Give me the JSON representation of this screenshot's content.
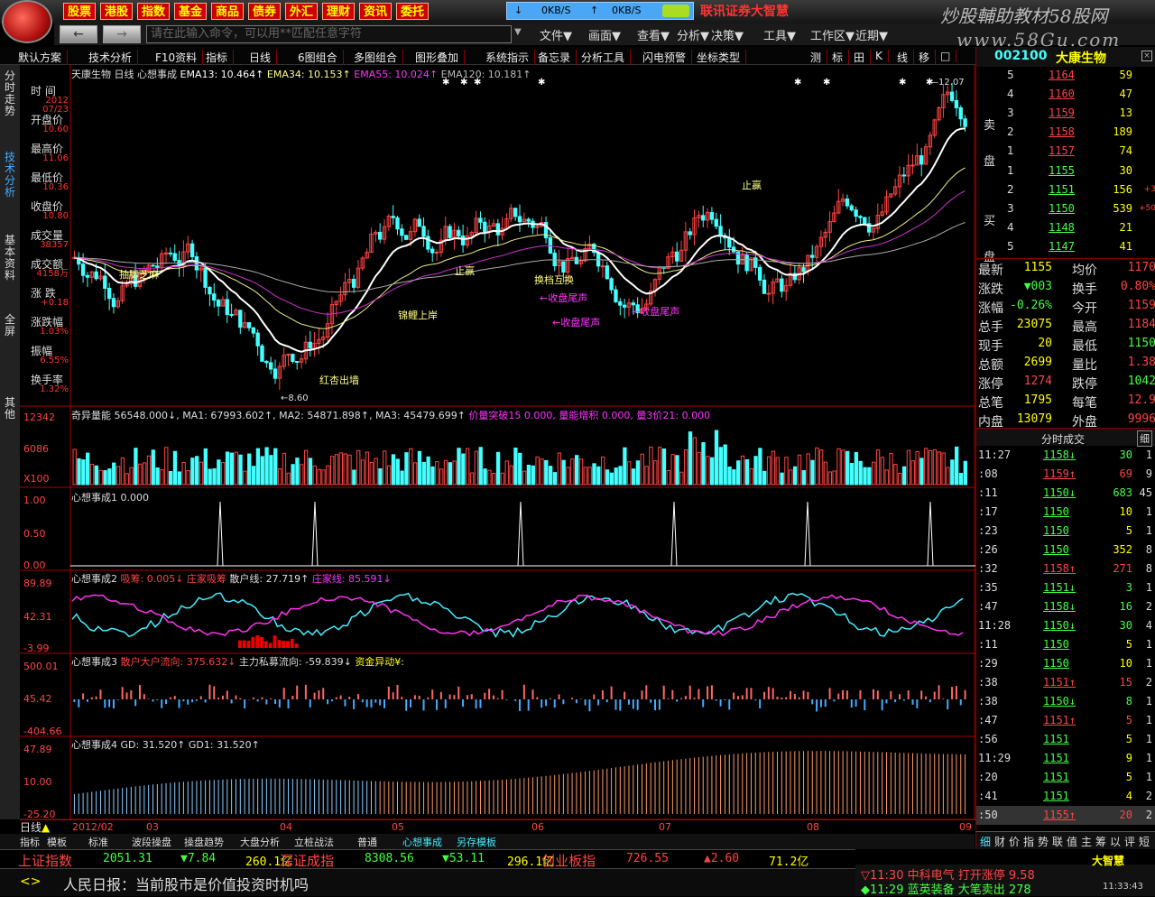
{
  "nav": [
    "股票",
    "港股",
    "指数",
    "基金",
    "商品",
    "债券",
    "外汇",
    "理财",
    "资讯",
    "委托"
  ],
  "net": {
    "down": "0KB/S",
    "up": "0KB/S"
  },
  "brand": "联讯证券大智慧",
  "watermark": "炒股輔助教材58股网",
  "watermark_url": "www.58Gu.com",
  "command_placeholder": "请在此输入命令，可以用**匹配任意字符",
  "menus": [
    "文件▼",
    "画面▼",
    "查看▼",
    "分析▼",
    "决策▼",
    "工具▼",
    "工作区▼",
    "近期▼"
  ],
  "toolbar3": [
    "默认方案",
    "技术分析",
    "F10资料",
    "指标",
    "日线",
    "6图组合",
    "多图组合",
    "图形叠加",
    "系统指示",
    "备忘录",
    "分析工具",
    "闪电预警",
    "坐标类型"
  ],
  "toolbar3_right": [
    "测",
    "标",
    "田",
    "K",
    "线",
    "移",
    "□"
  ],
  "leftstrip": [
    "分时走势",
    "技术分析",
    "基本资料",
    "全屏",
    "其他"
  ],
  "info": [
    {
      "label": "时 间",
      "value": "2012\n07/23"
    },
    {
      "label": "开盘价",
      "value": "10.60"
    },
    {
      "label": "最高价",
      "value": "11.06"
    },
    {
      "label": "最低价",
      "value": "10.36"
    },
    {
      "label": "收盘价",
      "value": "10.80"
    },
    {
      "label": "成交量",
      "value": "38357"
    },
    {
      "label": "成交额",
      "value": "4158万"
    },
    {
      "label": "涨 跌",
      "value": "+0.18"
    },
    {
      "label": "涨跌幅",
      "value": "1.03%"
    },
    {
      "label": "振幅",
      "value": "6.55%"
    },
    {
      "label": "换手率",
      "value": "1.32%"
    }
  ],
  "main_chart": {
    "title": "天康生物",
    "period": "日线",
    "indicator": "心想事成",
    "ema13": "EMA13: 10.464↑",
    "ema34": "EMA34: 10.153↑",
    "ema55": "EMA55: 10.024↑",
    "ema120": "EMA120: 10.181↑",
    "low_label": "8.60",
    "high_label": "12.07",
    "annotations": [
      "抽脚芝麻",
      "红杏出墙",
      "锦鲤上岸",
      "止赢",
      "止赢",
      "换档互换",
      "←收盘尾声",
      "←收盘尾声",
      "←收盘尾声"
    ]
  },
  "volume": {
    "title": "奇异量能",
    "values": "56548.000↓, MA1: 67993.602↑, MA2: 54871.898↑, MA3: 45479.699↑",
    "extra": "价量突破15  0.000, 量能增积  0.000, 量3价21: 0.000",
    "axis": [
      "12342",
      "6086",
      "X100"
    ]
  },
  "panel1": {
    "title": "心想事成1",
    "value": "0.000",
    "axis": [
      "1.00",
      "0.50",
      "0.00"
    ]
  },
  "panel2": {
    "title": "心想事成2",
    "a": "吸筹: 0.005↓",
    "b": "庄家吸筹",
    "c": "散户线: 27.719↑",
    "d": "庄家线: 85.591↓",
    "axis": [
      "89.89",
      "42.31",
      "-3.99"
    ]
  },
  "panel3": {
    "title": "心想事成3",
    "a": "散户大户流向: 375.632↓",
    "b": "主力私募流向: -59.839↓",
    "c": "资金异动¥:",
    "axis": [
      "500.01",
      "45.42",
      "-404.66"
    ]
  },
  "panel4": {
    "title": "心想事成4",
    "a": "GD: 31.520↑",
    "b": "GD1: 31.520↑",
    "axis": [
      "47.89",
      "10.00",
      "-25.20"
    ]
  },
  "dates": [
    "2012/02",
    "03",
    "04",
    "05",
    "06",
    "07",
    "08",
    "09"
  ],
  "period_label": "日线",
  "bottom_tabs": [
    "指标",
    "模板",
    "标准",
    "波段操盘",
    "操盘趋势",
    "大盘分析",
    "立桩战法",
    "普通",
    "心想事成",
    "另存模板"
  ],
  "stock": {
    "code": "002100",
    "name": "大康生物"
  },
  "sell": [
    [
      "5",
      "1164",
      "59"
    ],
    [
      "4",
      "1160",
      "47"
    ],
    [
      "3",
      "1159",
      "13"
    ],
    [
      "2",
      "1158",
      "189"
    ],
    [
      "1",
      "1157",
      "74"
    ]
  ],
  "buy": [
    [
      "1",
      "1155",
      "30",
      ""
    ],
    [
      "2",
      "1151",
      "156",
      "+3"
    ],
    [
      "3",
      "1150",
      "539",
      "+50"
    ],
    [
      "4",
      "1148",
      "21",
      ""
    ],
    [
      "5",
      "1147",
      "41",
      ""
    ]
  ],
  "stats": [
    [
      "最新",
      "1155",
      "均价",
      "1170"
    ],
    [
      "涨跌",
      "▼003",
      "换手",
      "0.80%"
    ],
    [
      "涨幅",
      "-0.26%",
      "今开",
      "1159"
    ],
    [
      "总手",
      "23075",
      "最高",
      "1184"
    ],
    [
      "现手",
      "20",
      "最低",
      "1150"
    ],
    [
      "总额",
      "2699",
      "量比",
      "1.38"
    ],
    [
      "涨停",
      "1274",
      "跌停",
      "1042"
    ],
    [
      "总笔",
      "1795",
      "每笔",
      "12.9"
    ],
    [
      "内盘",
      "13079",
      "外盘",
      "9996"
    ]
  ],
  "ticks_title": "分时成交",
  "ticks_btn": "细",
  "ticks": [
    [
      "11:27",
      "1158↓",
      "30",
      "1"
    ],
    [
      ":08",
      "1159↑",
      "69",
      "9"
    ],
    [
      ":11",
      "1150↓",
      "683",
      "45"
    ],
    [
      ":17",
      "1150",
      "10",
      "1"
    ],
    [
      ":23",
      "1150",
      "5",
      "1"
    ],
    [
      ":26",
      "1150",
      "352",
      "8"
    ],
    [
      ":32",
      "1158↑",
      "271",
      "8"
    ],
    [
      ":35",
      "1151↓",
      "3",
      "1"
    ],
    [
      ":47",
      "1158↓",
      "16",
      "2"
    ],
    [
      "11:28",
      "1150↓",
      "30",
      "4"
    ],
    [
      ":11",
      "1150",
      "5",
      "1"
    ],
    [
      ":29",
      "1150",
      "10",
      "1"
    ],
    [
      ":38",
      "1151↑",
      "15",
      "2"
    ],
    [
      ":38",
      "1150↓",
      "8",
      "1"
    ],
    [
      ":47",
      "1151↑",
      "5",
      "1"
    ],
    [
      ":56",
      "1151",
      "5",
      "1"
    ],
    [
      "11:29",
      "1151",
      "9",
      "1"
    ],
    [
      ":20",
      "1151",
      "5",
      "1"
    ],
    [
      ":41",
      "1151",
      "4",
      "2"
    ],
    [
      ":50",
      "1155↑",
      "20",
      "2"
    ]
  ],
  "right_tabs": [
    "细",
    "财",
    "价",
    "指",
    "势",
    "联",
    "值",
    "主",
    "筹",
    "以",
    "评",
    "短"
  ],
  "ticker": [
    {
      "name": "上证指数",
      "v1": "2051.31",
      "v2": "▼7.84",
      "v3": "260.1亿"
    },
    {
      "name": "深证成指",
      "v1": "8308.56",
      "v2": "▼53.11",
      "v3": "296.1亿"
    },
    {
      "name": "创业板指",
      "v1": "726.55",
      "v2": "▲2.60",
      "v3": "71.2亿"
    }
  ],
  "news": "人民日报：当前股市是价值投资时机吗",
  "alerts": [
    "▽11:30 中科电气 打开涨停 9.58",
    "◆11:29 蓝英装备 大笔卖出 278"
  ],
  "clock": "11:33:43",
  "dzh": "大智慧"
}
